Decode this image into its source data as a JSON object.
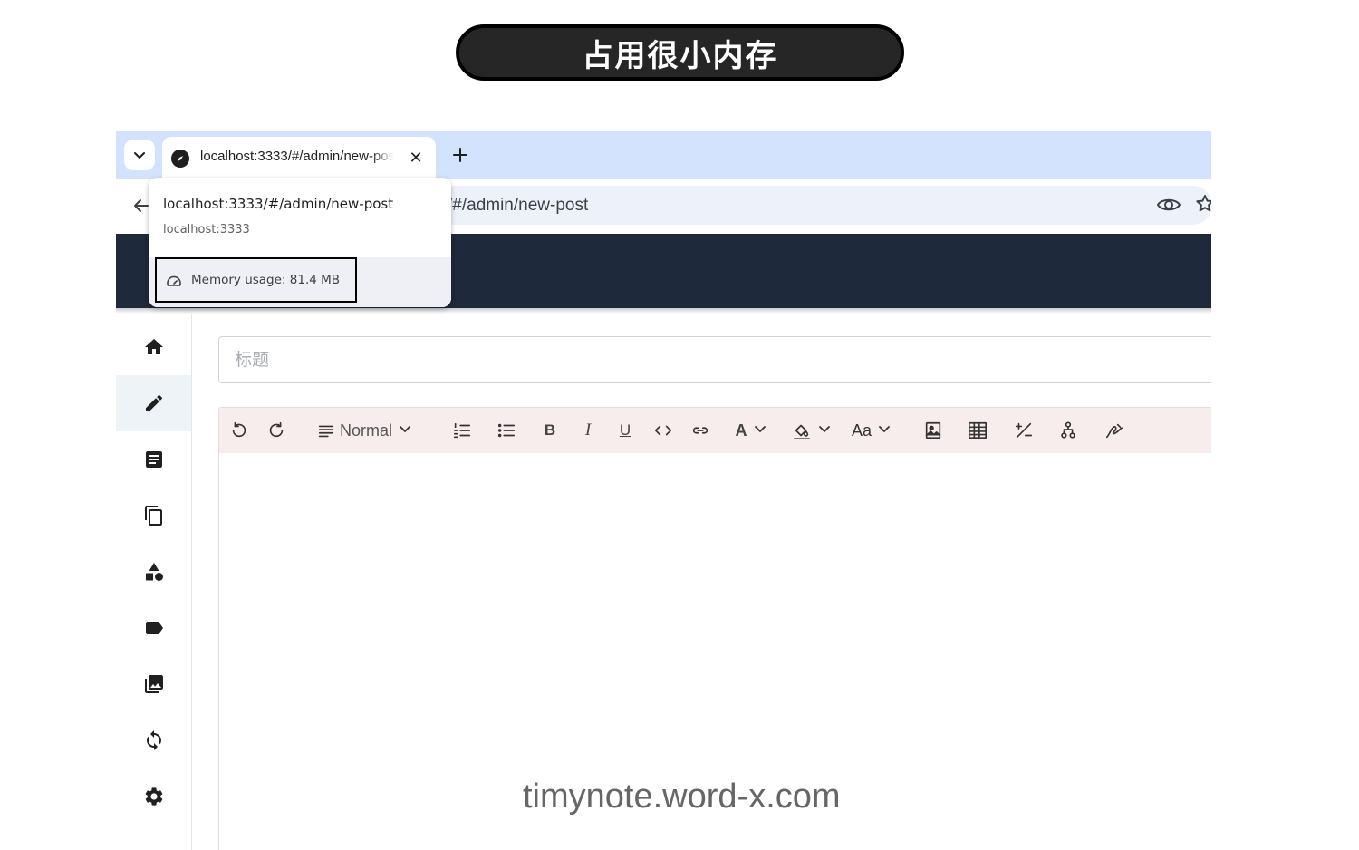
{
  "banner": {
    "text": "占用很小内存"
  },
  "browser": {
    "tab": {
      "title": "localhost:3333/#/admin/new-post"
    },
    "omnibox": {
      "url_visible": "/#/admin/new-post"
    },
    "hovercard": {
      "title": "localhost:3333/#/admin/new-post",
      "origin": "localhost:3333",
      "memory": "Memory usage: 81.4 MB"
    }
  },
  "sidebar": {
    "items": [
      {
        "icon": "home-icon"
      },
      {
        "icon": "pencil-icon",
        "active": true
      },
      {
        "icon": "article-icon"
      },
      {
        "icon": "copy-pages-icon"
      },
      {
        "icon": "shapes-category-icon"
      },
      {
        "icon": "tag-icon"
      },
      {
        "icon": "photo-library-icon"
      },
      {
        "icon": "sync-icon"
      },
      {
        "icon": "gear-icon"
      }
    ]
  },
  "editor": {
    "title_placeholder": "标题",
    "block_format": "Normal",
    "font_size_label": "Aa"
  },
  "watermark": "timynote.word-x.com",
  "colors": {
    "tabstrip": "#d3e3fd",
    "app_header": "#1e293b",
    "editor_toolbar": "#f8eded",
    "banner": "#262626"
  }
}
